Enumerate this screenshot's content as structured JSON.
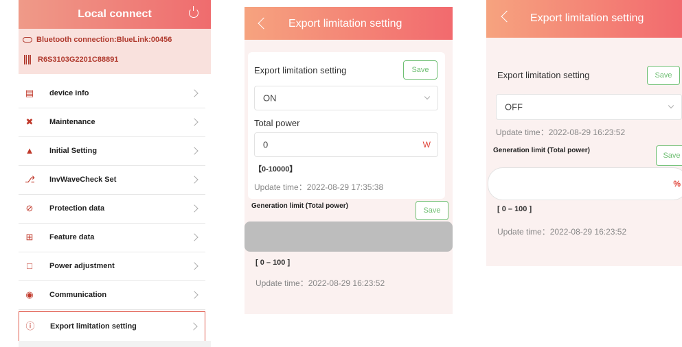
{
  "panel1": {
    "title": "Local connect",
    "bluetooth": "Bluetooth connection:BlueLink:00456",
    "serial": "R6S3103G2201C88891",
    "items": [
      {
        "label": "device info",
        "icon": "document-list-icon"
      },
      {
        "label": "Maintenance",
        "icon": "wrench-icon"
      },
      {
        "label": "Initial Setting",
        "icon": "tower-icon"
      },
      {
        "label": "InvWaveCheck Set",
        "icon": "antenna-icon"
      },
      {
        "label": "Protection data",
        "icon": "shield-icon"
      },
      {
        "label": "Feature data",
        "icon": "calendar-icon"
      },
      {
        "label": "Power adjustment",
        "icon": "chart-icon"
      },
      {
        "label": "Communication",
        "icon": "signal-icon"
      },
      {
        "label": "Export limitation setting",
        "icon": "info-icon"
      }
    ],
    "active_index": 8
  },
  "panel2": {
    "title": "Export limitation setting",
    "section_label": "Export limitation setting",
    "save_label": "Save",
    "mode_value": "ON",
    "total_power_label": "Total power",
    "total_power_value": "0",
    "total_power_unit": "W",
    "range": "【0-10000】",
    "update_time": "Update time：2022-08-29 17:35:38",
    "gen_limit_label": "Generation limit (Total power)",
    "gen_save_label": "Save",
    "gen_range": "[ 0 – 100 ]",
    "gen_update_time": "Update time：2022-08-29 16:23:52"
  },
  "panel3": {
    "title": "Export limitation setting",
    "section_label": "Export limitation setting",
    "save_label": "Save",
    "mode_value": "OFF",
    "update_time": "Update time：2022-08-29 16:23:52",
    "gen_limit_label": "Generation limit (Total power)",
    "gen_save_label": "Save",
    "gen_unit": "%",
    "gen_range": "[ 0 – 100 ]",
    "gen_update_time": "Update time：2022-08-29 16:23:52"
  },
  "colors": {
    "accent": "#ef6c6e",
    "save_green": "#6fbf73",
    "unit_red": "#e0453a",
    "header_tint": "#f9e1dd"
  }
}
